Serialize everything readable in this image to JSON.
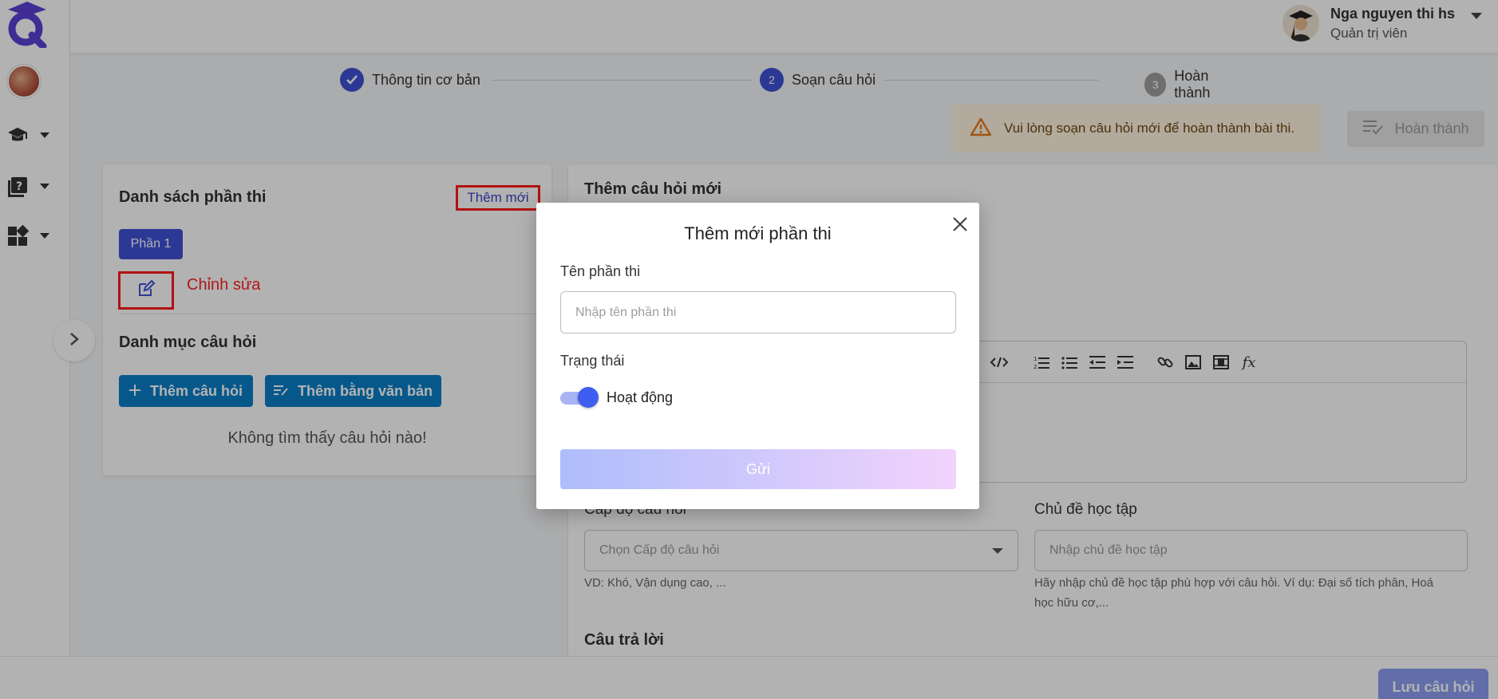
{
  "user": {
    "name": "Nga nguyen thi hs",
    "role": "Quản trị viên"
  },
  "stepper": {
    "steps": [
      {
        "num": "✓",
        "label": "Thông tin cơ bản",
        "state": "done"
      },
      {
        "num": "2",
        "label": "Soạn câu hỏi",
        "state": "active"
      },
      {
        "num": "3",
        "label": "Hoàn thành",
        "state": "pending"
      }
    ]
  },
  "warning": {
    "text": "Vui lòng soạn câu hỏi mới để hoàn thành bài thi."
  },
  "finish_button": "Hoàn thành",
  "left_panel": {
    "title": "Danh sách phần thi",
    "add_new": "Thêm mới",
    "part_chip": "Phần 1",
    "edit_label": "Chỉnh sửa",
    "category_title": "Danh mục câu hỏi",
    "add_question": "Thêm câu hỏi",
    "add_by_text": "Thêm bằng văn bản",
    "empty": "Không tìm thấy câu hỏi nào!"
  },
  "right_panel": {
    "title": "Thêm câu hỏi mới",
    "level_label": "Cấp độ câu hỏi",
    "level_placeholder": "Chọn Cấp độ câu hỏi",
    "level_hint": "VD: Khó, Vận dụng cao, ...",
    "topic_label": "Chủ đề học tập",
    "topic_placeholder": "Nhập chủ đề học tập",
    "topic_hint_1": "Hãy nhập chủ đề học tập phù hợp với câu hỏi. Ví dụ: Đại số tích phân, Hoá",
    "topic_hint_2": "học hữu cơ,...",
    "answers_title": "Câu trả lời",
    "formula_icon_text": "fx"
  },
  "save_button": "Lưu câu hỏi",
  "modal": {
    "title": "Thêm mới phần thi",
    "name_label": "Tên phần thi",
    "name_placeholder": "Nhập tên phần thi",
    "status_label": "Trạng thái",
    "status_value": "Hoạt động",
    "status_on": true,
    "submit": "Gửi"
  },
  "colors": {
    "primary": "#3f51d6",
    "action_blue": "#0a7fc7",
    "annotation_red": "#ff1a1a",
    "warning_bg": "#fff4e0"
  }
}
